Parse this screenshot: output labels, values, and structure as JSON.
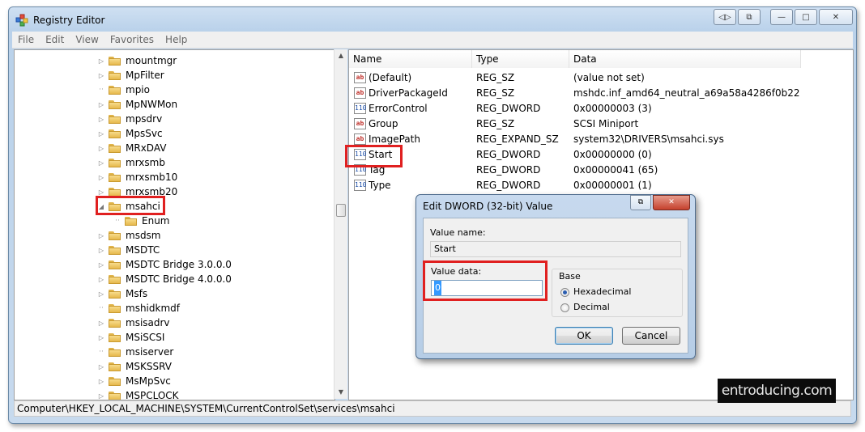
{
  "window": {
    "title": "Registry Editor"
  },
  "titlebar_buttons": {
    "extra1": "◁▷",
    "extra2": "⧉",
    "minimize": "—",
    "maximize": "□",
    "close": "✕"
  },
  "menu": [
    "File",
    "Edit",
    "View",
    "Favorites",
    "Help"
  ],
  "tree": [
    {
      "label": "mountmgr",
      "expander": "▷",
      "level": 0
    },
    {
      "label": "MpFilter",
      "expander": "▷",
      "level": 0
    },
    {
      "label": "mpio",
      "expander": "",
      "level": 0
    },
    {
      "label": "MpNWMon",
      "expander": "▷",
      "level": 0
    },
    {
      "label": "mpsdrv",
      "expander": "▷",
      "level": 0
    },
    {
      "label": "MpsSvc",
      "expander": "▷",
      "level": 0
    },
    {
      "label": "MRxDAV",
      "expander": "▷",
      "level": 0
    },
    {
      "label": "mrxsmb",
      "expander": "▷",
      "level": 0
    },
    {
      "label": "mrxsmb10",
      "expander": "▷",
      "level": 0
    },
    {
      "label": "mrxsmb20",
      "expander": "▷",
      "level": 0
    },
    {
      "label": "msahci",
      "expander": "◢",
      "level": 0,
      "selected": true
    },
    {
      "label": "Enum",
      "expander": "",
      "level": 1
    },
    {
      "label": "msdsm",
      "expander": "▷",
      "level": 0
    },
    {
      "label": "MSDTC",
      "expander": "▷",
      "level": 0
    },
    {
      "label": "MSDTC Bridge 3.0.0.0",
      "expander": "▷",
      "level": 0
    },
    {
      "label": "MSDTC Bridge 4.0.0.0",
      "expander": "▷",
      "level": 0
    },
    {
      "label": "Msfs",
      "expander": "▷",
      "level": 0
    },
    {
      "label": "mshidkmdf",
      "expander": "",
      "level": 0
    },
    {
      "label": "msisadrv",
      "expander": "▷",
      "level": 0
    },
    {
      "label": "MSiSCSI",
      "expander": "▷",
      "level": 0
    },
    {
      "label": "msiserver",
      "expander": "",
      "level": 0
    },
    {
      "label": "MSKSSRV",
      "expander": "▷",
      "level": 0
    },
    {
      "label": "MsMpSvc",
      "expander": "▷",
      "level": 0
    },
    {
      "label": "MSPCLOCK",
      "expander": "▷",
      "level": 0
    }
  ],
  "tree_scroll": {
    "up": "▲",
    "down": "▼"
  },
  "list": {
    "columns": [
      "Name",
      "Type",
      "Data"
    ],
    "rows": [
      {
        "icon": "string-value-icon",
        "glyph": "ab",
        "name": "(Default)",
        "type": "REG_SZ",
        "data": "(value not set)"
      },
      {
        "icon": "string-value-icon",
        "glyph": "ab",
        "name": "DriverPackageId",
        "type": "REG_SZ",
        "data": "mshdc.inf_amd64_neutral_a69a58a4286f0b22"
      },
      {
        "icon": "dword-value-icon",
        "glyph": "110",
        "name": "ErrorControl",
        "type": "REG_DWORD",
        "data": "0x00000003 (3)"
      },
      {
        "icon": "string-value-icon",
        "glyph": "ab",
        "name": "Group",
        "type": "REG_SZ",
        "data": "SCSI Miniport"
      },
      {
        "icon": "string-value-icon",
        "glyph": "ab",
        "name": "ImagePath",
        "type": "REG_EXPAND_SZ",
        "data": "system32\\DRIVERS\\msahci.sys"
      },
      {
        "icon": "dword-value-icon",
        "glyph": "110",
        "name": "Start",
        "type": "REG_DWORD",
        "data": "0x00000000 (0)"
      },
      {
        "icon": "dword-value-icon",
        "glyph": "110",
        "name": "Tag",
        "type": "REG_DWORD",
        "data": "0x00000041 (65)"
      },
      {
        "icon": "dword-value-icon",
        "glyph": "110",
        "name": "Type",
        "type": "REG_DWORD",
        "data": "0x00000001 (1)"
      }
    ]
  },
  "statusbar": {
    "path": "Computer\\HKEY_LOCAL_MACHINE\\SYSTEM\\CurrentControlSet\\services\\msahci"
  },
  "dialog": {
    "title": "Edit DWORD (32-bit) Value",
    "restore_glyph": "⧉",
    "close_glyph": "✕",
    "value_name_label": "Value name:",
    "value_name": "Start",
    "value_data_label": "Value data:",
    "value_data": "0",
    "base_label": "Base",
    "hex_label": "Hexadecimal",
    "dec_label": "Decimal",
    "base_selected": "Hexadecimal",
    "ok_label": "OK",
    "cancel_label": "Cancel"
  },
  "watermark": "entroducing.com",
  "colors": {
    "highlight": "#e02020",
    "string_icon": "#c0302a",
    "dword_icon": "#1d4fa8"
  }
}
